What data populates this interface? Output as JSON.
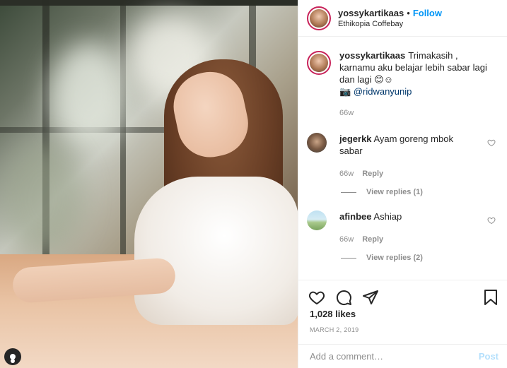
{
  "post": {
    "username": "yossykartikaas",
    "follow_label": "Follow",
    "dot": "•",
    "location": "Ethikopia Coffebay"
  },
  "caption": {
    "username": "yossykartikaas",
    "text": "Trimakasih , karnamu aku belajar lebih sabar lagi dan lagi 😊☺",
    "camera": "📷",
    "mention": "@ridwanyunip",
    "time": "66w"
  },
  "comments": [
    {
      "username": "jegerkk",
      "text": "Ayam goreng mbok sabar",
      "time": "66w",
      "reply_label": "Reply",
      "view_replies": "View replies (1)"
    },
    {
      "username": "afinbee",
      "text": "Ashiap",
      "time": "66w",
      "reply_label": "Reply",
      "view_replies": "View replies (2)"
    }
  ],
  "actions": {
    "icons": [
      "heart-icon",
      "comment-icon",
      "share-icon",
      "bookmark-icon"
    ],
    "likes": "1,028 likes",
    "date": "MARCH 2, 2019"
  },
  "composer": {
    "placeholder": "Add a comment…",
    "post_label": "Post"
  },
  "colors": {
    "follow": "#0095f6",
    "post_disabled": "#b2dffc",
    "story_ring": "#c8235a",
    "muted": "#8e8e8e"
  }
}
